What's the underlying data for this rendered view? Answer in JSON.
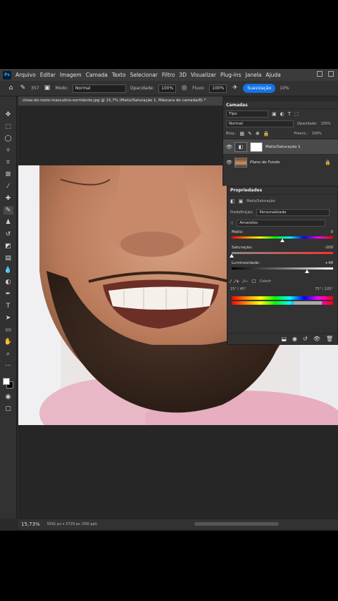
{
  "menu": [
    "Arquivo",
    "Editar",
    "Imagem",
    "Camada",
    "Texto",
    "Selecionar",
    "Filtro",
    "3D",
    "Visualizar",
    "Plug-ins",
    "Janela",
    "Ajuda"
  ],
  "logo": "Ps",
  "options": {
    "brush_size": "357",
    "mode_label": "Modo:",
    "mode_value": "Normal",
    "opacity_label": "Opacidade:",
    "opacity_value": "100%",
    "flow_label": "Fluxo:",
    "flow_value": "100%",
    "smoothing_button": "Suavização",
    "smoothing_value": "10%"
  },
  "document_tab": "close-do-rosto-masculino-sorridente.jpg @ 15,7% (Matiz/Saturação 1, Máscara de camada/8) *",
  "status": {
    "zoom": "15,73%",
    "dimensions": "5591 px x 3729 px (300 ppi)"
  },
  "layers_panel": {
    "title": "Camadas",
    "filter_kind": "Tipo",
    "blend_mode": "Normal",
    "opacity_label": "Opacidade:",
    "opacity_value": "100%",
    "lock_label": "Bloq.:",
    "fill_label": "Preenc.:",
    "fill_value": "100%",
    "layers": [
      {
        "name": "Matiz/Saturação 1",
        "type": "adjustment"
      },
      {
        "name": "Plano de Fundo",
        "type": "background"
      }
    ]
  },
  "properties_panel": {
    "title": "Propriedades",
    "adjustment_name": "Matiz/Saturação",
    "preset_label": "Predefinição:",
    "preset_value": "Personalizado",
    "channel": "Amarelos",
    "hue_label": "Matiz:",
    "hue_value": "0",
    "hue_level": 0.5,
    "saturation_label": "Saturação:",
    "saturation_value": "-100",
    "saturation_level": 0.0,
    "lightness_label": "Luminosidade:",
    "lightness_value": "+48",
    "lightness_level": 0.74,
    "colorize_label": "Colorir",
    "range_left": "15° / 45°",
    "range_right": "75° \\ 105°"
  }
}
